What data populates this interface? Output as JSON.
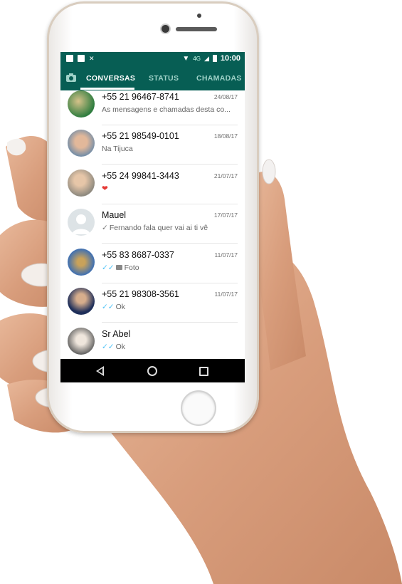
{
  "statusbar": {
    "network": "4G",
    "time": "10:00"
  },
  "tabs": [
    {
      "label": "CONVERSAS",
      "active": true
    },
    {
      "label": "STATUS",
      "active": false
    },
    {
      "label": "CHAMADAS",
      "active": false
    }
  ],
  "chats": [
    {
      "name": "+55 21 96467-8741",
      "date": "24/08/17",
      "preview": "As mensagens e chamadas desta co..."
    },
    {
      "name": "+55 21 98549-0101",
      "date": "18/08/17",
      "preview": "Na Tijuca"
    },
    {
      "name": "+55 24 99841-3443",
      "date": "21/07/17",
      "preview": "❤"
    },
    {
      "name": "Mauel",
      "date": "17/07/17",
      "preview": "Fernando fala quer vai ai ti vê"
    },
    {
      "name": "+55 83 8687-0337",
      "date": "11/07/17",
      "preview": "Foto"
    },
    {
      "name": "+55 21 98308-3561",
      "date": "11/07/17",
      "preview": "Ok"
    },
    {
      "name": "Sr Abel",
      "date": "",
      "preview": "Ok"
    }
  ],
  "icons": {
    "camera_tab": "camera-icon",
    "fab": "chat-icon",
    "nav": [
      "back-icon",
      "home-icon",
      "recents-icon"
    ]
  },
  "colors": {
    "header": "#075e54",
    "fab": "#25d366",
    "read_ticks": "#4fc3f7"
  }
}
